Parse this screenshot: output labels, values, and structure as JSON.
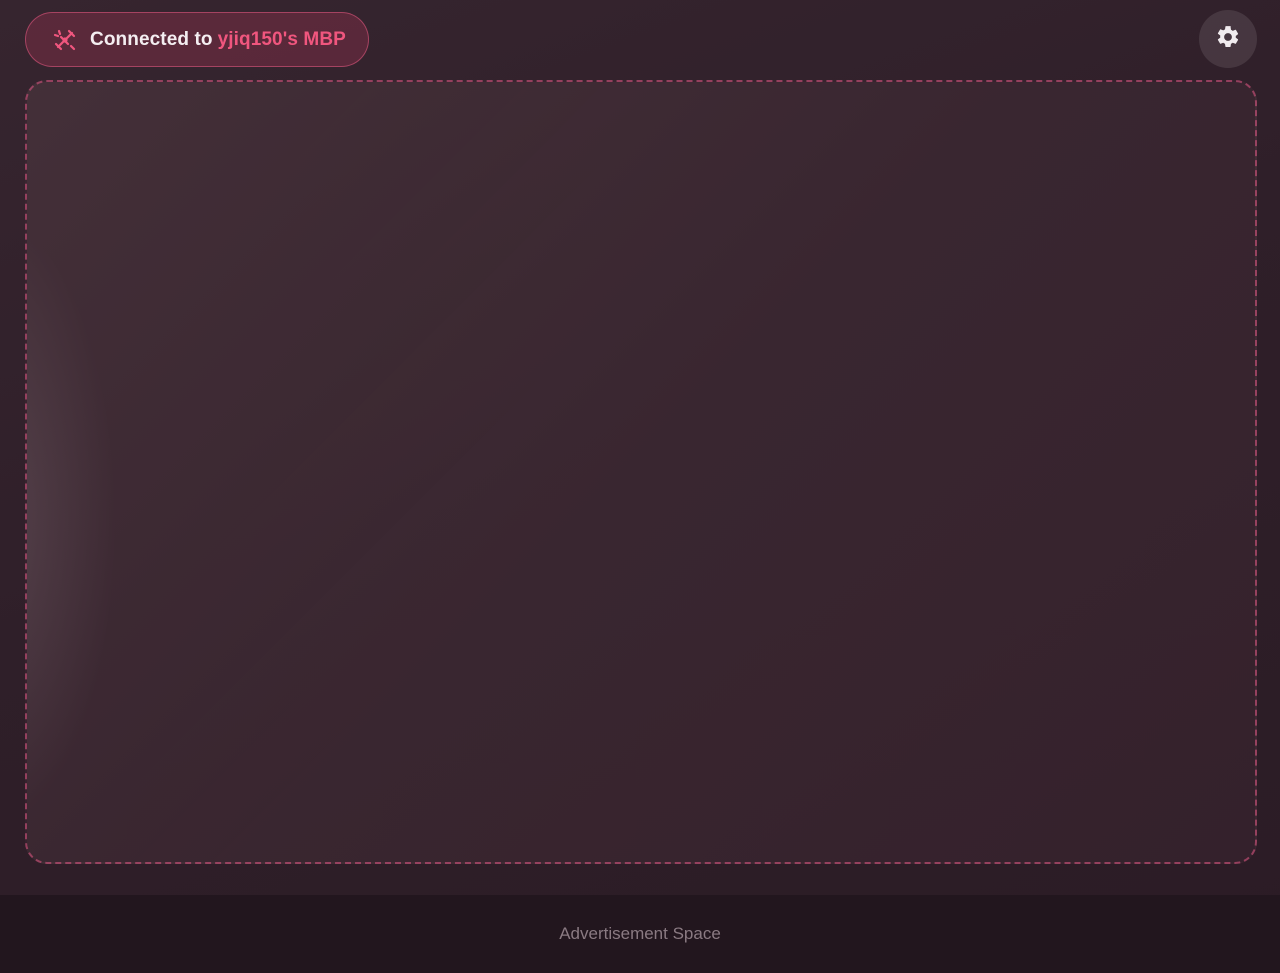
{
  "status": {
    "prefix": "Connected to",
    "device_name": "yjiq150's MBP",
    "icon": "plug-icon",
    "accent_color": "#f0567e"
  },
  "settings": {
    "icon": "gear-icon"
  },
  "drop_zone": {
    "border_color": "#c85078"
  },
  "footer": {
    "ad_label": "Advertisement Space"
  }
}
